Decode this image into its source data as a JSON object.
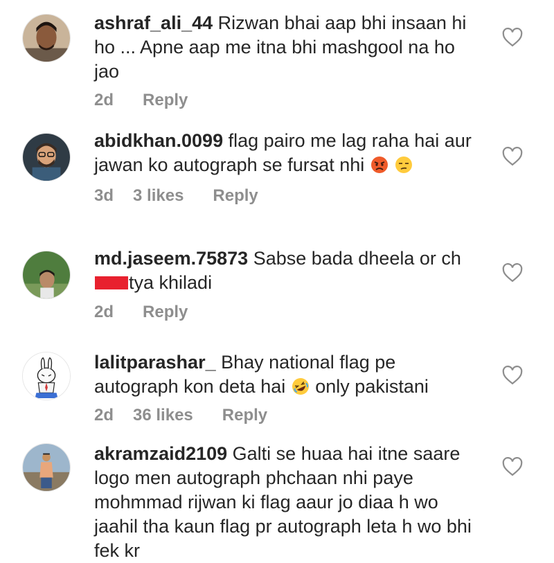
{
  "comments": [
    {
      "username": "ashraf_ali_44",
      "text": "Rizwan bhai aap bhi insaan hi ho ... Apne aap me itna bhi mashgool na ho jao",
      "time": "2d",
      "likes": "",
      "reply": "Reply"
    },
    {
      "username": "abidkhan.0099",
      "text": "flag pairo me lag raha hai aur jawan ko autograph se fursat nhi",
      "emojis": [
        "angry-face-emoji",
        "unamused-face-emoji"
      ],
      "time": "3d",
      "likes": "3 likes",
      "reply": "Reply"
    },
    {
      "username": "md.jaseem.75873",
      "text_before": "Sabse bada dheela or ch",
      "text_after": "tya khiladi",
      "time": "2d",
      "likes": "",
      "reply": "Reply"
    },
    {
      "username": "lalitparashar_",
      "text_before": "Bhay national flag pe autograph kon deta hai",
      "emoji": "rolling-on-floor-laughing-emoji",
      "text_after": "only pakistani",
      "time": "2d",
      "likes": "36 likes",
      "reply": "Reply"
    },
    {
      "username": "akramzaid2109",
      "text": "Galti se huaa hai itne saare logo men autograph phchaan nhi paye mohmmad rijwan ki flag aaur jo diaa h wo jaahil tha kaun flag pr autograph leta h wo bhi fek kr"
    }
  ],
  "colors": {
    "text": "#262626",
    "meta": "#8e8e8e",
    "censor": "#e8212e"
  }
}
